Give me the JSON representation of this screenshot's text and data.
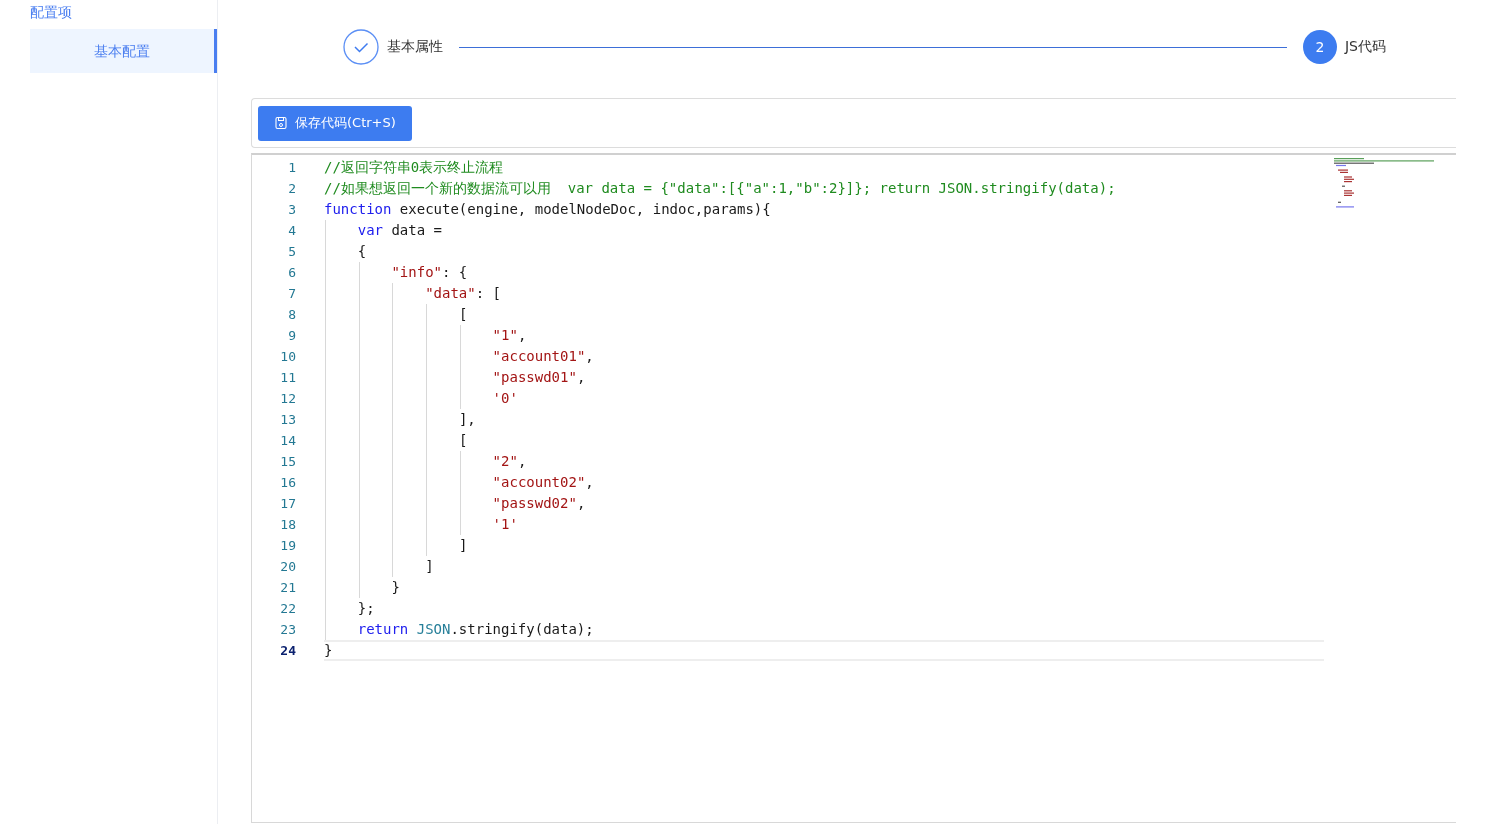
{
  "sidebar": {
    "title": "配置项",
    "items": [
      {
        "label": "基本配置",
        "selected": true
      }
    ]
  },
  "steps": [
    {
      "label": "基本属性",
      "completed": true
    },
    {
      "label": "JS代码",
      "completed": false,
      "number": "2"
    }
  ],
  "toolbar": {
    "save_button": "保存代码(Ctr+S)"
  },
  "editor": {
    "lines": [
      {
        "number": "1",
        "current": false,
        "tokens": [
          {
            "kind": "comment",
            "text": "//返回字符串0表示终止流程"
          }
        ]
      },
      {
        "number": "2",
        "current": false,
        "tokens": [
          {
            "kind": "comment",
            "text": "//如果想返回一个新的数据流可以用  var data = {\"data\":[{\"a\":1,\"b\":2}]}; return JSON.stringify(data);"
          }
        ]
      },
      {
        "number": "3",
        "current": false,
        "tokens": [
          {
            "kind": "keyword",
            "text": "function"
          },
          {
            "kind": "plain",
            "text": " execute(engine, modelNodeDoc, indoc,params){"
          }
        ],
        "children": [
          {
            "number": "4",
            "current": false,
            "tokens": [
              {
                "kind": "keyword",
                "text": "var"
              },
              {
                "kind": "plain",
                "text": " data ="
              }
            ]
          },
          {
            "number": "5",
            "current": false,
            "tokens": [
              {
                "kind": "plain",
                "text": "{"
              }
            ],
            "children": [
              {
                "number": "6",
                "current": false,
                "tokens": [
                  {
                    "kind": "string",
                    "text": "\"info\""
                  },
                  {
                    "kind": "plain",
                    "text": ": {"
                  }
                ],
                "children": [
                  {
                    "number": "7",
                    "current": false,
                    "tokens": [
                      {
                        "kind": "string",
                        "text": "\"data\""
                      },
                      {
                        "kind": "plain",
                        "text": ": ["
                      }
                    ],
                    "children": [
                      {
                        "number": "8",
                        "current": false,
                        "tokens": [
                          {
                            "kind": "plain",
                            "text": "["
                          }
                        ],
                        "children": [
                          {
                            "number": "9",
                            "current": false,
                            "tokens": [
                              {
                                "kind": "string",
                                "text": "\"1\""
                              },
                              {
                                "kind": "plain",
                                "text": ","
                              }
                            ]
                          },
                          {
                            "number": "10",
                            "current": false,
                            "tokens": [
                              {
                                "kind": "string",
                                "text": "\"account01\""
                              },
                              {
                                "kind": "plain",
                                "text": ","
                              }
                            ]
                          },
                          {
                            "number": "11",
                            "current": false,
                            "tokens": [
                              {
                                "kind": "string",
                                "text": "\"passwd01\""
                              },
                              {
                                "kind": "plain",
                                "text": ","
                              }
                            ]
                          },
                          {
                            "number": "12",
                            "current": false,
                            "tokens": [
                              {
                                "kind": "string",
                                "text": "'0'"
                              }
                            ]
                          }
                        ]
                      },
                      {
                        "number": "13",
                        "current": false,
                        "tokens": [
                          {
                            "kind": "plain",
                            "text": "],"
                          }
                        ]
                      },
                      {
                        "number": "14",
                        "current": false,
                        "tokens": [
                          {
                            "kind": "plain",
                            "text": "["
                          }
                        ],
                        "children": [
                          {
                            "number": "15",
                            "current": false,
                            "tokens": [
                              {
                                "kind": "string",
                                "text": "\"2\""
                              },
                              {
                                "kind": "plain",
                                "text": ","
                              }
                            ]
                          },
                          {
                            "number": "16",
                            "current": false,
                            "tokens": [
                              {
                                "kind": "string",
                                "text": "\"account02\""
                              },
                              {
                                "kind": "plain",
                                "text": ","
                              }
                            ]
                          },
                          {
                            "number": "17",
                            "current": false,
                            "tokens": [
                              {
                                "kind": "string",
                                "text": "\"passwd02\""
                              },
                              {
                                "kind": "plain",
                                "text": ","
                              }
                            ]
                          },
                          {
                            "number": "18",
                            "current": false,
                            "tokens": [
                              {
                                "kind": "string",
                                "text": "'1'"
                              }
                            ]
                          }
                        ]
                      },
                      {
                        "number": "19",
                        "current": false,
                        "tokens": [
                          {
                            "kind": "plain",
                            "text": "]"
                          }
                        ]
                      }
                    ]
                  },
                  {
                    "number": "20",
                    "current": false,
                    "tokens": [
                      {
                        "kind": "plain",
                        "text": "]"
                      }
                    ]
                  }
                ]
              },
              {
                "number": "21",
                "current": false,
                "tokens": [
                  {
                    "kind": "plain",
                    "text": "}"
                  }
                ]
              }
            ]
          },
          {
            "number": "22",
            "current": false,
            "tokens": [
              {
                "kind": "plain",
                "text": "};"
              }
            ]
          },
          {
            "number": "23",
            "current": false,
            "tokens": [
              {
                "kind": "keyword",
                "text": "return"
              },
              {
                "kind": "builtin",
                "text": "JSON"
              },
              {
                "kind": "plain",
                "text": ".stringify(data);"
              }
            ]
          }
        ]
      },
      {
        "number": "24",
        "current": true,
        "tokens": [
          {
            "kind": "plain",
            "text": "}"
          }
        ]
      }
    ]
  }
}
